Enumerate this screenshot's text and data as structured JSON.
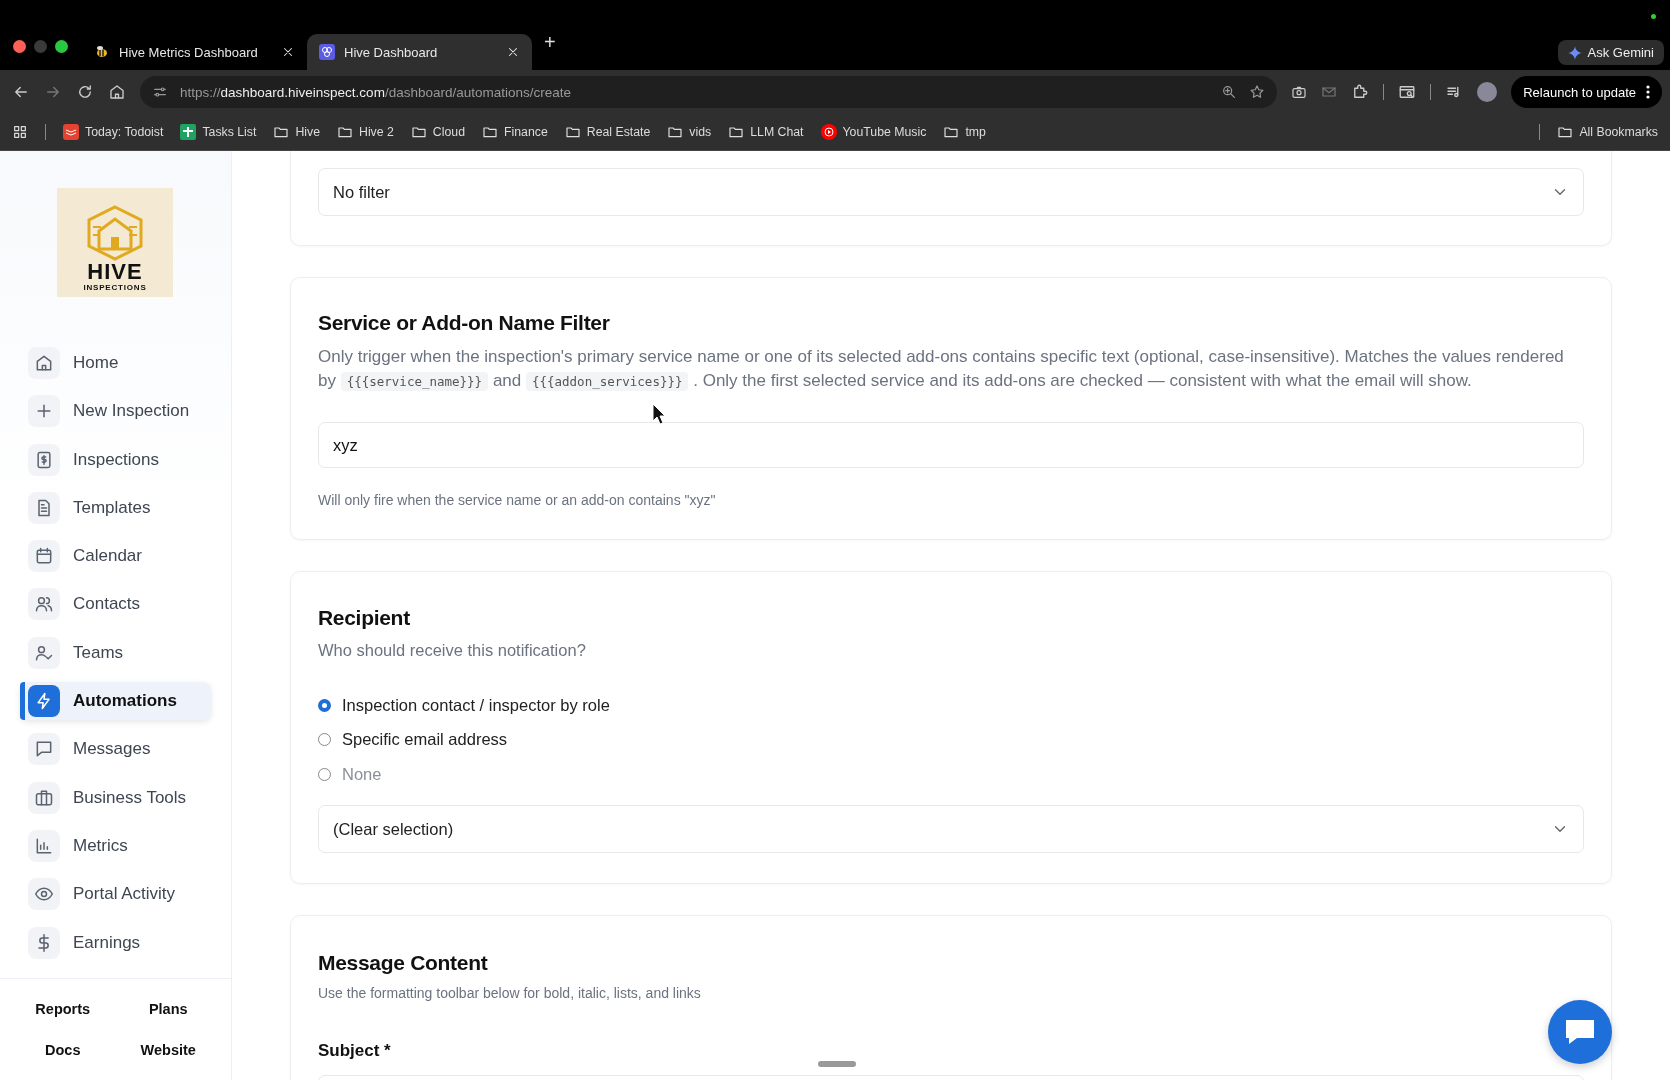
{
  "browser": {
    "tabs": [
      {
        "title": "Hive Metrics Dashboard",
        "selected": false
      },
      {
        "title": "Hive Dashboard",
        "selected": true
      }
    ],
    "new_tab": "+",
    "ask_gemini": "Ask Gemini",
    "url": {
      "scheme": "https://",
      "host": "dashboard.hiveinspect.com",
      "path": "/dashboard/automations/create"
    },
    "relaunch": "Relaunch to update",
    "bookmarks": [
      {
        "label": "Today: Todoist",
        "kind": "todoist"
      },
      {
        "label": "Tasks List",
        "kind": "sheets"
      },
      {
        "label": "Hive",
        "kind": "folder"
      },
      {
        "label": "Hive 2",
        "kind": "folder"
      },
      {
        "label": "Cloud",
        "kind": "folder"
      },
      {
        "label": "Finance",
        "kind": "folder"
      },
      {
        "label": "Real Estate",
        "kind": "folder"
      },
      {
        "label": "vids",
        "kind": "folder"
      },
      {
        "label": "LLM Chat",
        "kind": "folder"
      },
      {
        "label": "YouTube Music",
        "kind": "music"
      },
      {
        "label": "tmp",
        "kind": "folder"
      }
    ],
    "all_bookmarks": "All Bookmarks"
  },
  "sidebar": {
    "logo": {
      "title": "HIVE",
      "subtitle": "INSPECTIONS"
    },
    "items": [
      {
        "label": "Home",
        "selected": false
      },
      {
        "label": "New Inspection",
        "selected": false
      },
      {
        "label": "Inspections",
        "selected": false
      },
      {
        "label": "Templates",
        "selected": false
      },
      {
        "label": "Calendar",
        "selected": false
      },
      {
        "label": "Contacts",
        "selected": false
      },
      {
        "label": "Teams",
        "selected": false
      },
      {
        "label": "Automations",
        "selected": true
      },
      {
        "label": "Messages",
        "selected": false
      },
      {
        "label": "Business Tools",
        "selected": false
      },
      {
        "label": "Metrics",
        "selected": false
      },
      {
        "label": "Portal Activity",
        "selected": false
      },
      {
        "label": "Earnings",
        "selected": false
      }
    ],
    "footer_links": [
      "Reports",
      "Plans",
      "Docs",
      "Website"
    ]
  },
  "filter_card": {
    "select_value": "No filter"
  },
  "name_filter": {
    "title": "Service or Add-on Name Filter",
    "description": [
      {
        "kind": "text",
        "text": "Only trigger when the inspection's primary service name or one of its selected add-ons contains specific text (optional, case-insensitive). Matches the values rendered by "
      },
      {
        "kind": "code",
        "text": "{{{service_name}}}"
      },
      {
        "kind": "text",
        "text": " and "
      },
      {
        "kind": "code",
        "text": "{{{addon_services}}}"
      },
      {
        "kind": "text",
        "text": " . Only the first selected service and its add-ons are checked — consistent with what the email will show."
      }
    ],
    "value": "xyz",
    "hint": "Will only fire when the service name or an add-on contains \"xyz\""
  },
  "recipient": {
    "title": "Recipient",
    "subtitle": "Who should receive this notification?",
    "options": [
      {
        "label": "Inspection contact / inspector by role",
        "selected": true,
        "disabled": false
      },
      {
        "label": "Specific email address",
        "selected": false,
        "disabled": false
      },
      {
        "label": "None",
        "selected": false,
        "disabled": true
      }
    ],
    "select_value": "(Clear selection)"
  },
  "message_content": {
    "title": "Message Content",
    "subtitle": "Use the formatting toolbar below for bold, italic, lists, and links",
    "subject_label": "Subject *"
  }
}
